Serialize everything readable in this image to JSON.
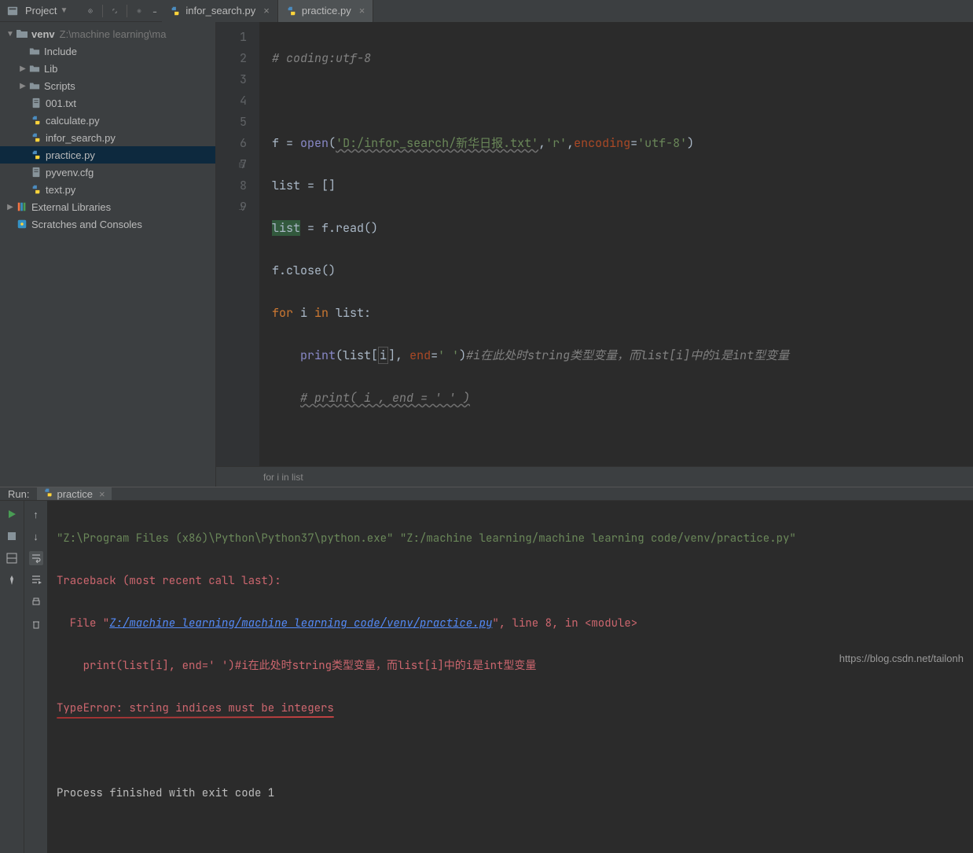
{
  "toolbar": {
    "project_label": "Project"
  },
  "tabs": [
    {
      "label": "infor_search.py",
      "active": false
    },
    {
      "label": "practice.py",
      "active": true
    }
  ],
  "tree": {
    "root": {
      "label": "venv",
      "path": "Z:\\machine learning\\ma"
    },
    "items": [
      {
        "label": "Include",
        "type": "folder",
        "indent": 1,
        "arrow": ""
      },
      {
        "label": "Lib",
        "type": "folder",
        "indent": 1,
        "arrow": "▶"
      },
      {
        "label": "Scripts",
        "type": "folder",
        "indent": 1,
        "arrow": "▶"
      },
      {
        "label": "001.txt",
        "type": "txt",
        "indent": 2
      },
      {
        "label": "calculate.py",
        "type": "py",
        "indent": 2
      },
      {
        "label": "infor_search.py",
        "type": "py",
        "indent": 2
      },
      {
        "label": "practice.py",
        "type": "py",
        "indent": 2,
        "selected": true
      },
      {
        "label": "pyvenv.cfg",
        "type": "txt",
        "indent": 2
      },
      {
        "label": "text.py",
        "type": "py",
        "indent": 2
      }
    ],
    "external": "External Libraries",
    "scratches": "Scratches and Consoles"
  },
  "code": {
    "lines": 9,
    "l1_comment": "# coding:utf-8",
    "l3_var": "f",
    "l3_eq": " = ",
    "l3_open": "open",
    "l3_str1": "'D:/infor_search/新华日报.txt'",
    "l3_c1": ",",
    "l3_str2": "'r'",
    "l3_c2": ",",
    "l3_enc": "encoding",
    "l3_eq2": "=",
    "l3_str3": "'utf-8'",
    "l3_close": ")",
    "l4": "list = []",
    "l5_list": "list",
    "l5_rest": " = f.read()",
    "l6": "f.close()",
    "l7_for": "for",
    "l7_mid": " i ",
    "l7_in": "in",
    "l7_end": " list:",
    "l8_indent": "    ",
    "l8_print": "print",
    "l8_open": "(list[",
    "l8_i": "i",
    "l8_close1": "], ",
    "l8_end": "end",
    "l8_eq": "=",
    "l8_str": "' '",
    "l8_close2": ")",
    "l8_comment": "#i在此处时string类型变量，而list[i]中的i是int型变量",
    "l9_indent": "    ",
    "l9_comment": "# print( i , end = ' ' )"
  },
  "breadcrumb": "for i in list",
  "run": {
    "title": "Run:",
    "tab": "practice",
    "cmd_py": "\"Z:\\Program Files (x86)\\Python\\Python37\\python.exe\"",
    "cmd_sp": " ",
    "cmd_file": "\"Z:/machine learning/machine learning code/venv/practice.py\"",
    "traceback": "Traceback (most recent call last):",
    "file_prefix": "  File \"",
    "file_link": "Z:/machine learning/machine learning code/venv/practice.py",
    "file_suffix": "\", line 8, in <module>",
    "code_line": "    print(list[i], end=' ')#i在此处时string类型变量，而list[i]中的i是int型变量",
    "error": "TypeError: string indices must be integers",
    "exit": "Process finished with exit code 1"
  },
  "watermark": "https://blog.csdn.net/tailonh"
}
